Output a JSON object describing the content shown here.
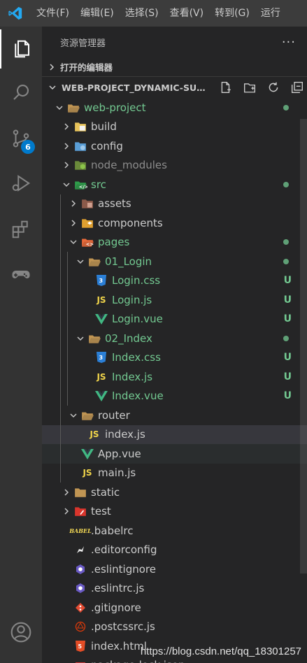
{
  "menu": [
    "文件(F)",
    "编辑(E)",
    "选择(S)",
    "查看(V)",
    "转到(G)",
    "运行"
  ],
  "activity": {
    "source_control_badge": "6"
  },
  "explorer": {
    "title": "资源管理器",
    "more": "···",
    "open_editors": "打开的编辑器",
    "project": "WEB-PROJECT_DYNAMIC-SUB..."
  },
  "tree": [
    {
      "label": "web-project",
      "chev": "down",
      "icon": "folder-open-icon",
      "status": "dot",
      "color": "green"
    },
    {
      "label": "build",
      "chev": "right",
      "icon": "folder-build-icon"
    },
    {
      "label": "config",
      "chev": "right",
      "icon": "folder-config-icon"
    },
    {
      "label": "node_modules",
      "chev": "right",
      "icon": "folder-node-icon",
      "color": "dim"
    },
    {
      "label": "src",
      "chev": "down",
      "icon": "folder-src-icon",
      "status": "dot",
      "color": "green"
    },
    {
      "label": "assets",
      "chev": "right",
      "icon": "folder-assets-icon"
    },
    {
      "label": "components",
      "chev": "right",
      "icon": "folder-components-icon"
    },
    {
      "label": "pages",
      "chev": "down",
      "icon": "folder-pages-icon",
      "status": "dot",
      "color": "green"
    },
    {
      "label": "01_Login",
      "chev": "down",
      "icon": "folder-open-icon",
      "status": "dot",
      "color": "green"
    },
    {
      "label": "Login.css",
      "icon": "css-icon",
      "status": "U",
      "color": "green"
    },
    {
      "label": "Login.js",
      "icon": "js-icon",
      "status": "U",
      "color": "green"
    },
    {
      "label": "Login.vue",
      "icon": "vue-icon",
      "status": "U",
      "color": "green"
    },
    {
      "label": "02_Index",
      "chev": "down",
      "icon": "folder-open-icon",
      "status": "dot",
      "color": "green"
    },
    {
      "label": "Index.css",
      "icon": "css-icon",
      "status": "U",
      "color": "green"
    },
    {
      "label": "Index.js",
      "icon": "js-icon",
      "status": "U",
      "color": "green"
    },
    {
      "label": "Index.vue",
      "icon": "vue-icon",
      "status": "U",
      "color": "green"
    },
    {
      "label": "router",
      "chev": "down",
      "icon": "folder-open-icon"
    },
    {
      "label": "index.js",
      "icon": "js-icon",
      "state": "hover"
    },
    {
      "label": "App.vue",
      "icon": "vue-icon",
      "state": "selected"
    },
    {
      "label": "main.js",
      "icon": "js-icon"
    },
    {
      "label": "static",
      "chev": "right",
      "icon": "folder-static-icon"
    },
    {
      "label": "test",
      "chev": "right",
      "icon": "folder-test-icon"
    },
    {
      "label": ".babelrc",
      "icon": "babel-icon"
    },
    {
      "label": ".editorconfig",
      "icon": "editorconfig-icon"
    },
    {
      "label": ".eslintignore",
      "icon": "eslint-icon"
    },
    {
      "label": ".eslintrc.js",
      "icon": "eslint-icon"
    },
    {
      "label": ".gitignore",
      "icon": "git-icon"
    },
    {
      "label": ".postcssrc.js",
      "icon": "postcss-icon"
    },
    {
      "label": "index.html",
      "icon": "html-icon"
    },
    {
      "label": "package-lock.json",
      "icon": "npm-icon"
    }
  ],
  "watermark": "https://blog.csdn.net/qq_18301257",
  "colors": {
    "accent": "#007acc",
    "untracked": "#73c991"
  }
}
